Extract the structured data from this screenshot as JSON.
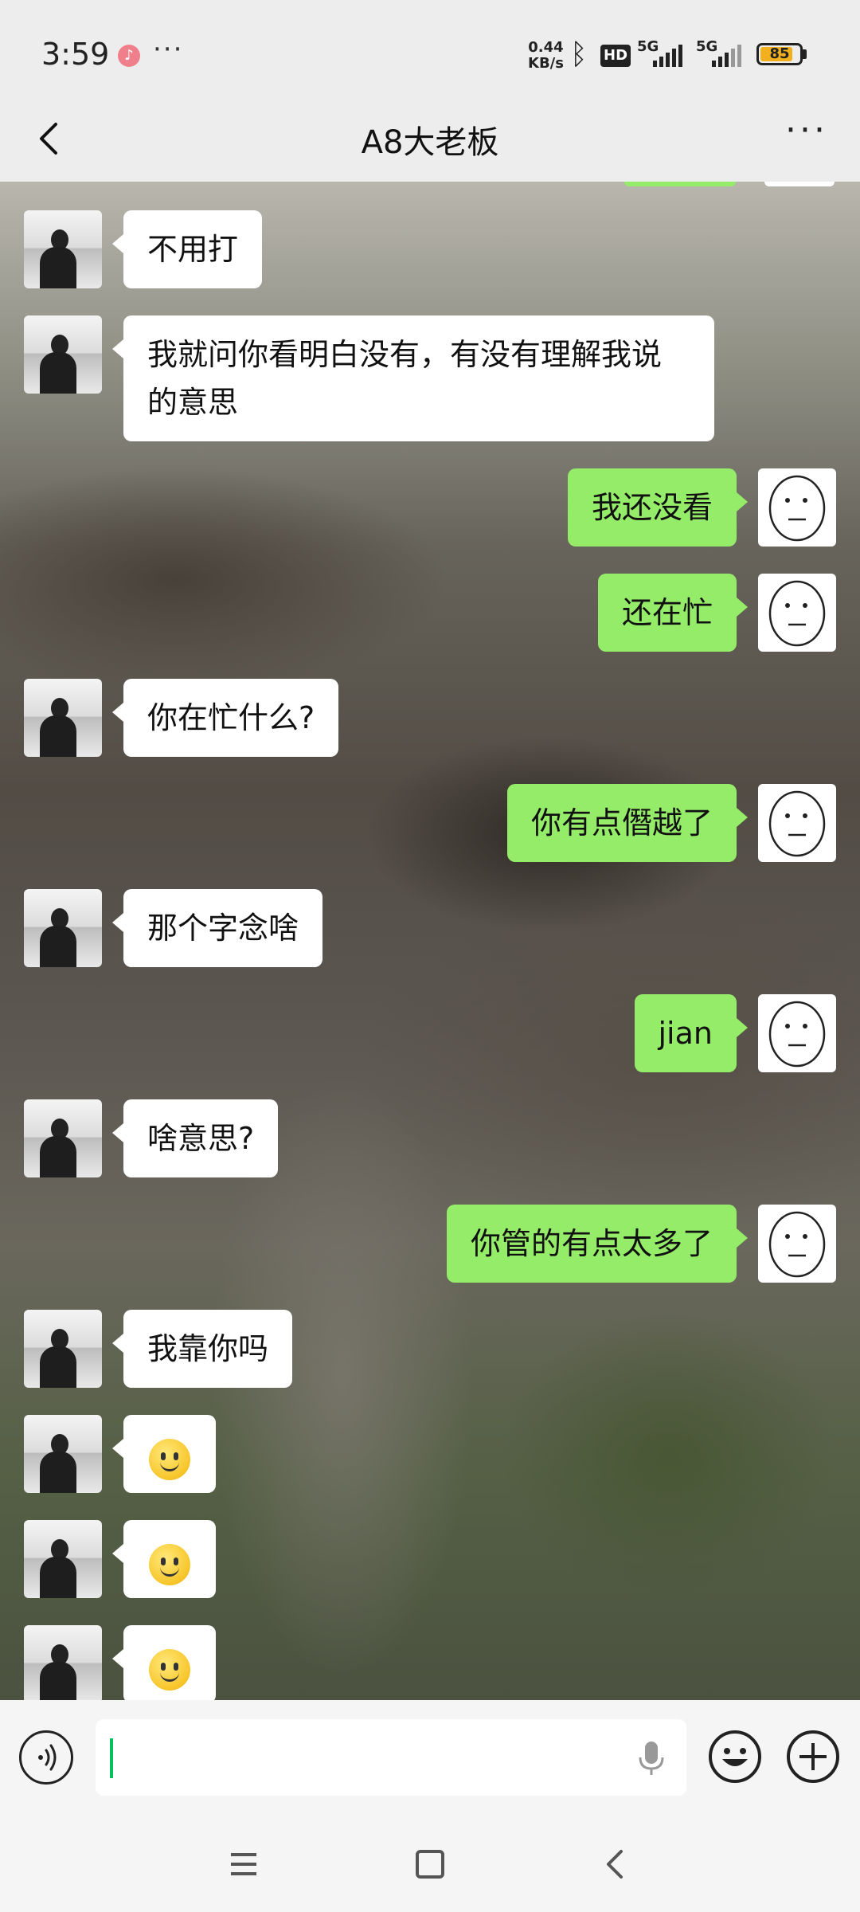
{
  "status_bar": {
    "time": "3:59",
    "net_speed_value": "0.44",
    "net_speed_unit": "KB/s",
    "hd_label": "HD",
    "signal1_label": "5G",
    "signal2_label": "5G",
    "battery_level": "85"
  },
  "header": {
    "title": "A8大老板"
  },
  "messages": [
    {
      "side": "left",
      "text": "不用打"
    },
    {
      "side": "left",
      "text": "我就问你看明白没有，有没有理解我说的意思"
    },
    {
      "side": "right",
      "text": "我还没看"
    },
    {
      "side": "right",
      "text": "还在忙"
    },
    {
      "side": "left",
      "text": "你在忙什么?"
    },
    {
      "side": "right",
      "text": "你有点僭越了"
    },
    {
      "side": "left",
      "text": "那个字念啥"
    },
    {
      "side": "right",
      "text": "jian"
    },
    {
      "side": "left",
      "text": "啥意思?"
    },
    {
      "side": "right",
      "text": "你管的有点太多了"
    },
    {
      "side": "left",
      "text": "我靠你吗"
    },
    {
      "side": "left",
      "emoji": "smile-emoji"
    },
    {
      "side": "left",
      "emoji": "smile-emoji"
    },
    {
      "side": "left",
      "emoji": "smile-emoji"
    }
  ],
  "input_bar": {
    "value": ""
  },
  "colors": {
    "sent_bubble": "#95ec69",
    "received_bubble": "#ffffff",
    "cursor": "#07c160"
  }
}
